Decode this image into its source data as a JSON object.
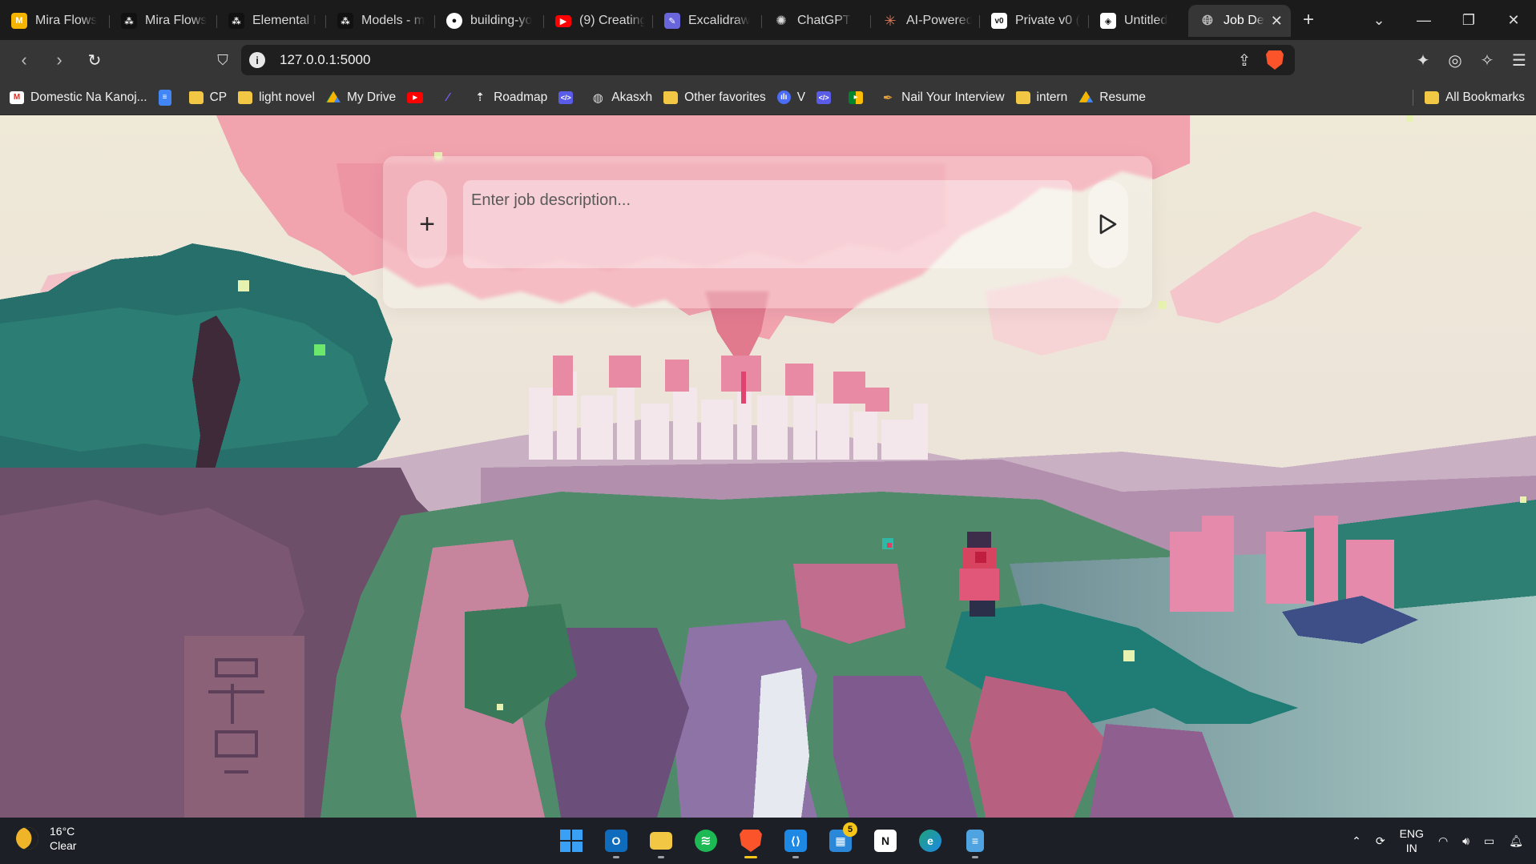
{
  "tabs": [
    {
      "label": "Mira Flows",
      "icon": "mira-icon",
      "color": "#f5b400"
    },
    {
      "label": "Mira Flows",
      "icon": "mira-icon",
      "color": "#111111"
    },
    {
      "label": "Elemental I",
      "icon": "mira-icon",
      "color": "#111111"
    },
    {
      "label": "Models - m",
      "icon": "mira-icon",
      "color": "#111111"
    },
    {
      "label": "building-yo",
      "icon": "github-icon",
      "color": "#ffffff"
    },
    {
      "label": "(9) Creating",
      "icon": "youtube-icon",
      "color": "#ff0000"
    },
    {
      "label": "Excalidraw",
      "icon": "excalidraw-icon",
      "color": "#6965db"
    },
    {
      "label": "ChatGPT",
      "icon": "chatgpt-icon",
      "color": "#444444"
    },
    {
      "label": "AI-Powered",
      "icon": "claude-icon",
      "color": "#d97757"
    },
    {
      "label": "Private v0 (",
      "icon": "v0-icon",
      "color": "#ffffff"
    },
    {
      "label": "Untitled",
      "icon": "untitled-icon",
      "color": "#ffffff"
    },
    {
      "label": "Job De",
      "icon": "globe-icon",
      "color": "#bbbbbb",
      "active": true
    }
  ],
  "address_bar": {
    "url": "127.0.0.1:5000"
  },
  "bookmarks": [
    {
      "label": "Domestic Na Kanoj...",
      "icon": "gmail-icon"
    },
    {
      "label": "",
      "icon": "docs-icon"
    },
    {
      "label": "CP",
      "icon": "folder-icon"
    },
    {
      "label": "light novel",
      "icon": "folder-icon"
    },
    {
      "label": "My Drive",
      "icon": "drive-icon"
    },
    {
      "label": "",
      "icon": "youtube-icon"
    },
    {
      "label": "",
      "icon": "feather-icon"
    },
    {
      "label": "Roadmap",
      "icon": "rocket-icon"
    },
    {
      "label": "",
      "icon": "code-icon"
    },
    {
      "label": "Akasxh",
      "icon": "globe-icon"
    },
    {
      "label": "Other favorites",
      "icon": "folder-icon"
    },
    {
      "label": "V",
      "icon": "voice-icon"
    },
    {
      "label": "",
      "icon": "code-icon"
    },
    {
      "label": "",
      "icon": "meet-icon"
    },
    {
      "label": "Nail Your Interview",
      "icon": "feather-icon"
    },
    {
      "label": "intern",
      "icon": "folder-icon"
    },
    {
      "label": "Resume",
      "icon": "drive-icon"
    }
  ],
  "all_bookmarks_label": "All Bookmarks",
  "job_form": {
    "placeholder": "Enter job description...",
    "add_label": "+",
    "send_icon": "play-icon"
  },
  "taskbar": {
    "weather": {
      "temp": "16°C",
      "condition": "Clear"
    },
    "apps": [
      {
        "name": "windows-start-icon",
        "color": "#3aa0f5"
      },
      {
        "name": "outlook-icon",
        "color": "#0f6cbd"
      },
      {
        "name": "file-explorer-icon",
        "color": "#f2c744"
      },
      {
        "name": "spotify-icon",
        "color": "#1db954"
      },
      {
        "name": "brave-icon",
        "color": "#fb542b",
        "active": true
      },
      {
        "name": "vscode-icon",
        "color": "#1e88e5"
      },
      {
        "name": "microsoft-store-icon",
        "color": "#2b88d8",
        "badge": "5"
      },
      {
        "name": "notion-icon",
        "color": "#ffffff"
      },
      {
        "name": "edge-icon",
        "color": "#1fa37a"
      },
      {
        "name": "notepad-icon",
        "color": "#4fa3e0"
      }
    ],
    "language": {
      "line1": "ENG",
      "line2": "IN"
    }
  }
}
